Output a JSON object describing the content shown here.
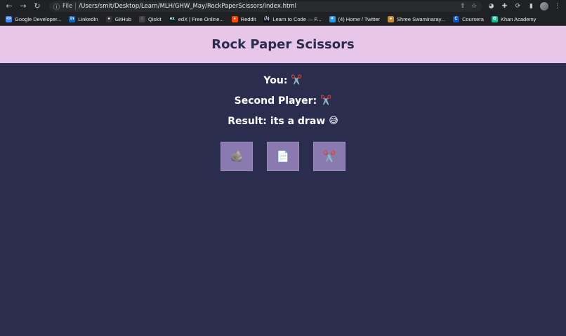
{
  "browser": {
    "address": {
      "scheme_label": "File",
      "url": "/Users/smit/Desktop/Learn/MLH/GHW_May/RockPaperScissors/index.html"
    },
    "bookmarks": [
      {
        "label": "Google Developer...",
        "icon": "google-dev-icon",
        "color": "#4285f4",
        "glyph": "<>"
      },
      {
        "label": "LinkedIn",
        "icon": "linkedin-icon",
        "color": "#0a66c2",
        "glyph": "in"
      },
      {
        "label": "GitHub",
        "icon": "github-icon",
        "color": "#333333",
        "glyph": "●"
      },
      {
        "label": "Qiskit",
        "icon": "qiskit-icon",
        "color": "#444444",
        "glyph": "◌"
      },
      {
        "label": "edX | Free Online...",
        "icon": "edx-icon",
        "color": "#02262b",
        "glyph": "ex"
      },
      {
        "label": "Reddit",
        "icon": "reddit-icon",
        "color": "#ff4500",
        "glyph": "●"
      },
      {
        "label": "Learn to Code — F...",
        "icon": "freecodecamp-icon",
        "color": "#0a0a23",
        "glyph": "(λ)"
      },
      {
        "label": "(4) Home / Twitter",
        "icon": "twitter-icon",
        "color": "#1d9bf0",
        "glyph": "✦"
      },
      {
        "label": "Shree Swaminaray...",
        "icon": "shree-icon",
        "color": "#c98a3a",
        "glyph": "●"
      },
      {
        "label": "Coursera",
        "icon": "coursera-icon",
        "color": "#0056d2",
        "glyph": "C"
      },
      {
        "label": "Khan Academy",
        "icon": "khan-icon",
        "color": "#14bf96",
        "glyph": "✿"
      }
    ]
  },
  "app": {
    "title": "Rock Paper Scissors",
    "you_label": "You:",
    "you_choice": "✂️",
    "second_label": "Second Player:",
    "second_choice": "✂️",
    "result_label": "Result:",
    "result_text": "its a draw",
    "result_emoji": "😅",
    "choices": [
      {
        "name": "rock",
        "glyph": "🪨"
      },
      {
        "name": "paper",
        "glyph": "📄"
      },
      {
        "name": "scissors",
        "glyph": "✂️"
      }
    ]
  }
}
